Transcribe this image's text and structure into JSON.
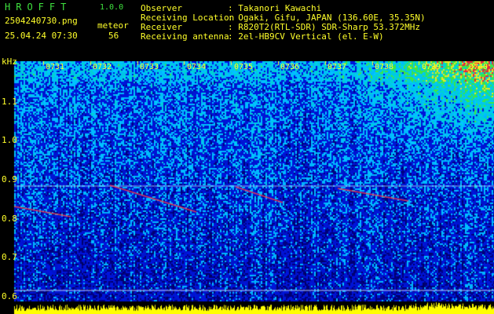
{
  "app": {
    "title": "HROFFT",
    "version": "1.0.0"
  },
  "file": {
    "name": "2504240730.png",
    "datetime": "25.04.24 07:30"
  },
  "meteor": {
    "label": "meteor",
    "count": "56"
  },
  "info": [
    {
      "label": "Observer",
      "value": ": Takanori Kawachi"
    },
    {
      "label": "Receiving Location",
      "value": ": Ogaki, Gifu, JAPAN (136.60E, 35.35N)"
    },
    {
      "label": "Receiver",
      "value": ": R820T2(RTL-SDR) SDR-Sharp 53.372MHz"
    },
    {
      "label": "Receiving antenna",
      "value": ": 2el-HB9CV Vertical (el. E-W)"
    }
  ],
  "axis": {
    "unit": "kHz",
    "y_ticks": [
      "1.1",
      "1.0",
      "0.9",
      "0.8",
      "0.7",
      "0.6"
    ],
    "x_ticks": [
      "0731",
      "0732",
      "0733",
      "0734",
      "0735",
      "0736",
      "0737",
      "0738",
      "0739",
      "0740"
    ]
  },
  "colors": {
    "label_green": "#3fe23f",
    "label_yellow": "#ffff2a",
    "trace": "#ff3030",
    "baseline": "#ffff00"
  }
}
